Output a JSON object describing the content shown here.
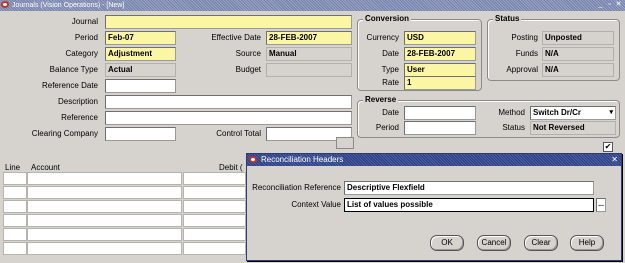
{
  "window": {
    "title": "Journals (Vision Operations) - [New]"
  },
  "journal": {
    "journal_label": "Journal",
    "journal_value": "",
    "period_label": "Period",
    "period_value": "Feb-07",
    "category_label": "Category",
    "category_value": "Adjustment",
    "balance_type_label": "Balance Type",
    "balance_type_value": "Actual",
    "reference_date_label": "Reference Date",
    "reference_date_value": "",
    "description_label": "Description",
    "description_value": "",
    "reference_label": "Reference",
    "reference_value": "",
    "clearing_company_label": "Clearing Company",
    "clearing_company_value": "",
    "effective_date_label": "Effective Date",
    "effective_date_value": "28-FEB-2007",
    "source_label": "Source",
    "source_value": "Manual",
    "budget_label": "Budget",
    "budget_value": "",
    "control_total_label": "Control Total",
    "control_total_value": ""
  },
  "conversion": {
    "title": "Conversion",
    "currency_label": "Currency",
    "currency_value": "USD",
    "date_label": "Date",
    "date_value": "28-FEB-2007",
    "type_label": "Type",
    "type_value": "User",
    "rate_label": "Rate",
    "rate_value": "1"
  },
  "status": {
    "title": "Status",
    "posting_label": "Posting",
    "posting_value": "Unposted",
    "funds_label": "Funds",
    "funds_value": "N/A",
    "approval_label": "Approval",
    "approval_value": "N/A"
  },
  "reverse": {
    "title": "Reverse",
    "date_label": "Date",
    "date_value": "",
    "period_label": "Period",
    "period_value": "",
    "method_label": "Method",
    "method_value": "Switch Dr/Cr",
    "status_label": "Status",
    "status_value": "Not Reversed"
  },
  "lines": {
    "line_header": "Line",
    "account_header": "Account",
    "debit_header": "Debit ("
  },
  "dialog": {
    "title": "Reconciliation Headers",
    "recon_ref_label": "Reconciliation Reference",
    "recon_ref_value": "Descriptive Flexfield",
    "context_label": "Context Value",
    "context_value": "List of values possible",
    "lov_button": "...",
    "ok": "OK",
    "cancel": "Cancel",
    "clear": "Clear",
    "help": "Help"
  }
}
